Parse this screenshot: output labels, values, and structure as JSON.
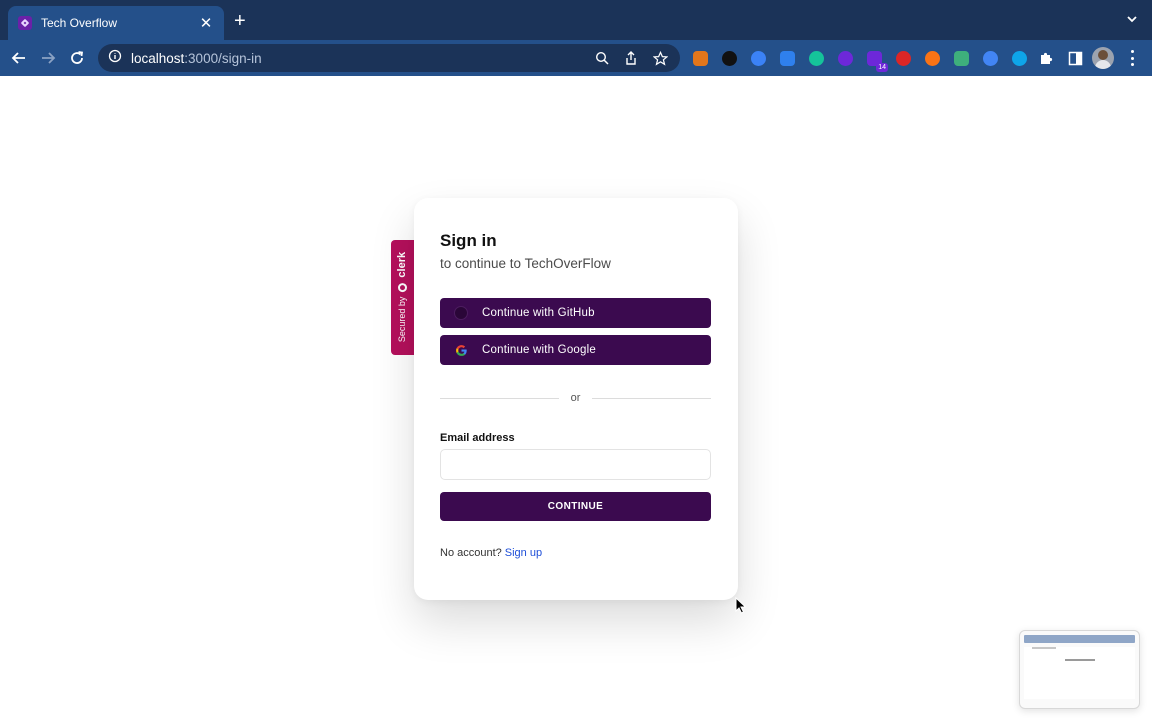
{
  "browser": {
    "tab_title": "Tech Overflow",
    "url_host": "localhost",
    "url_path": ":3000/sign-in",
    "extensions": [
      {
        "name": "fox-extension-icon",
        "color": "#e2761b"
      },
      {
        "name": "dots-extension-icon",
        "color": "#111111"
      },
      {
        "name": "droplet-extension-icon",
        "color": "#3b82f6"
      },
      {
        "name": "cloud-extension-icon",
        "color": "#2f80ed"
      },
      {
        "name": "grammarly-extension-icon",
        "color": "#15c39a"
      },
      {
        "name": "shield-extension-icon",
        "color": "#6d28d9"
      },
      {
        "name": "badge-extension-icon",
        "color": "#6d28d9",
        "badge": "14"
      },
      {
        "name": "red-c-extension-icon",
        "color": "#dc2626"
      },
      {
        "name": "a-extension-icon",
        "color": "#f97316"
      },
      {
        "name": "v-extension-icon",
        "color": "#3eaf7c"
      },
      {
        "name": "translate-extension-icon",
        "color": "#4285f4"
      },
      {
        "name": "k-extension-icon",
        "color": "#0ea5e9"
      }
    ]
  },
  "clerk_badge": {
    "secured_by": "Secured by",
    "brand": "clerk"
  },
  "signin": {
    "title": "Sign in",
    "subtitle": "to continue to TechOverFlow",
    "github_label": "Continue with GitHub",
    "google_label": "Continue with Google",
    "divider": "or",
    "email_label": "Email address",
    "email_value": "",
    "continue_label": "CONTINUE",
    "no_account": "No account?",
    "signup_link": "Sign up"
  },
  "colors": {
    "chrome_dark": "#1b3358",
    "chrome_light": "#24508a",
    "button_purple": "#3b0a4f",
    "clerk_pink": "#b5105c",
    "link_blue": "#1d4ed8"
  }
}
